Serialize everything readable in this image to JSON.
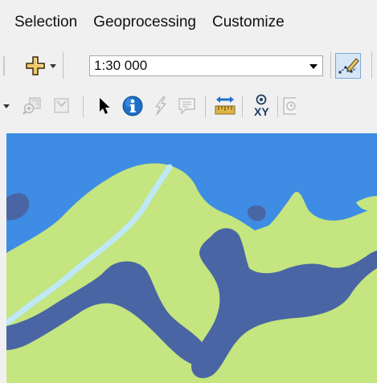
{
  "menu": {
    "selection": "Selection",
    "geoprocessing": "Geoprocessing",
    "customize": "Customize"
  },
  "toolbar": {
    "scale_value": "1:30 000",
    "add_data_icon": "add-data-plus-icon",
    "editor_icon": "editor-toolbar-icon"
  },
  "tools": [
    "fixed-zoom-in-icon",
    "fixed-zoom-out-icon",
    "select-elements-arrow-icon",
    "identify-icon",
    "hyperlink-lightning-icon",
    "html-popup-icon",
    "measure-icon",
    "go-to-xy-icon",
    "time-slider-icon"
  ],
  "colors": {
    "water": "#3e8ce3",
    "land": "#c4e57f",
    "deep_water": "#4a65a3",
    "river": "#bfe8f7",
    "identify_blue": "#1e6fc8"
  },
  "xy_label": "XY"
}
